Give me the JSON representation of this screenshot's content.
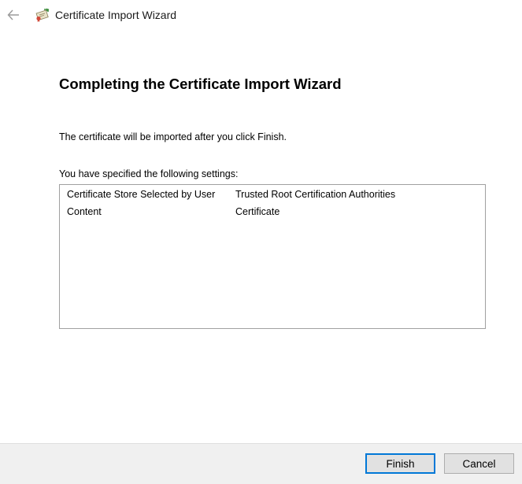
{
  "window": {
    "title": "Certificate Import Wizard",
    "back_icon": "back-arrow-icon",
    "app_icon": "certificate-icon"
  },
  "page": {
    "heading": "Completing the Certificate Import Wizard",
    "intro": "The certificate will be imported after you click Finish.",
    "settings_label": "You have specified the following settings:"
  },
  "settings": [
    {
      "key": "Certificate Store Selected by User",
      "value": "Trusted Root Certification Authorities"
    },
    {
      "key": "Content",
      "value": "Certificate"
    }
  ],
  "buttons": {
    "finish": "Finish",
    "cancel": "Cancel"
  },
  "colors": {
    "accent": "#0078d7",
    "footer_bg": "#f0f0f0",
    "button_bg": "#e1e1e1"
  }
}
